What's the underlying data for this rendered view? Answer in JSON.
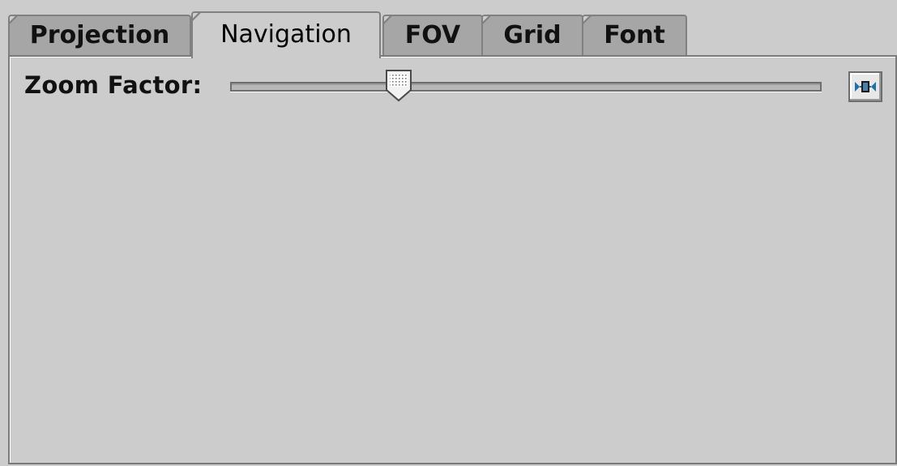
{
  "tabs": [
    {
      "label": "Projection",
      "selected": false
    },
    {
      "label": "Navigation",
      "selected": true
    },
    {
      "label": "FOV",
      "selected": false
    },
    {
      "label": "Grid",
      "selected": false
    },
    {
      "label": "Font",
      "selected": false
    }
  ],
  "navigation": {
    "zoom_label": "Zoom Factor:",
    "zoom_slider": {
      "min": 0,
      "max": 1,
      "value": 0.285
    },
    "fit_button_icon": "zoom-reset-icon"
  },
  "colors": {
    "background": "#cccccc",
    "tab_unselected": "#a6a6a6",
    "icon_accent": "#1f6fa8"
  }
}
